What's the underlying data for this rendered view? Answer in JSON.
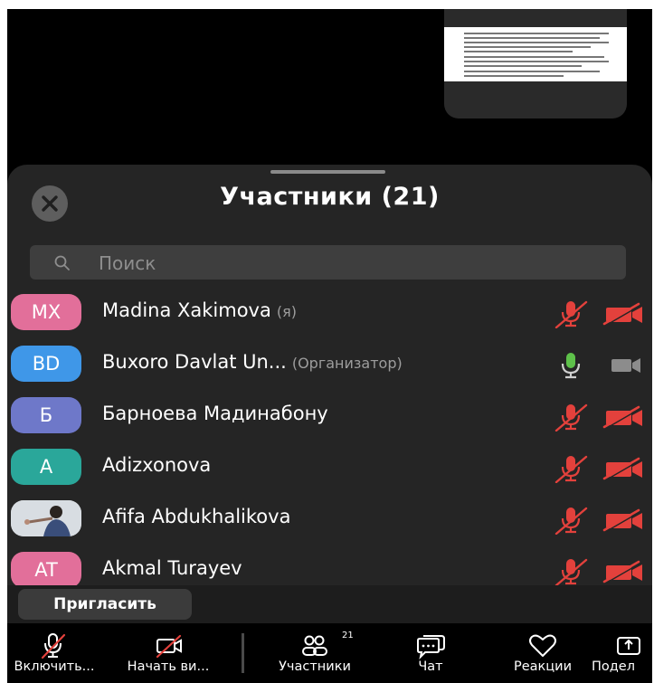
{
  "panel": {
    "title": "Участники (21)",
    "search_placeholder": "Поиск"
  },
  "participants": [
    {
      "initials": "MX",
      "name": "Madina Xakimova",
      "tag": "(я)",
      "avatar_color": "#e26f9a",
      "mic": "muted",
      "video": "off"
    },
    {
      "initials": "BD",
      "name": "Buxoro Davlat Un...",
      "tag": "(Организатор)",
      "avatar_color": "#3f97e8",
      "mic": "on",
      "video": "inactive"
    },
    {
      "initials": "Б",
      "name": "Барноева Мадинабону",
      "tag": "",
      "avatar_color": "#6e78c9",
      "mic": "muted",
      "video": "off"
    },
    {
      "initials": "A",
      "name": "Adizxonova",
      "tag": "",
      "avatar_color": "#2aa79a",
      "mic": "muted",
      "video": "off"
    },
    {
      "initials": "",
      "name": "Afifa Abdukhalikova",
      "tag": "",
      "avatar_color": "#cfcfcf",
      "mic": "muted",
      "video": "off"
    },
    {
      "initials": "AT",
      "name": "Akmal Turayev",
      "tag": "",
      "avatar_color": "#e26f9a",
      "mic": "muted",
      "video": "off"
    }
  ],
  "invite": {
    "label": "Пригласить"
  },
  "toolbar": {
    "unmute": "Включить...",
    "start_video": "Начать ви...",
    "participants": "Участники",
    "participants_count": "21",
    "chat": "Чат",
    "reactions": "Реакции",
    "share": "Подел"
  },
  "colors": {
    "muted_red": "#e3413c",
    "mic_green": "#5ec14a",
    "panel_bg": "#252525"
  },
  "icons": [
    "close-icon",
    "search-icon",
    "microphone-muted-icon",
    "microphone-icon",
    "video-off-icon",
    "video-icon",
    "participants-icon",
    "chat-icon",
    "heart-icon",
    "share-icon"
  ]
}
